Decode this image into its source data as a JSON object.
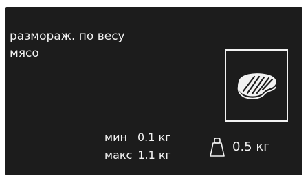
{
  "program": {
    "mode": "размораж. по весу",
    "food": "мясо",
    "food_icon": "meat-steak-icon"
  },
  "limits": {
    "min_label": "мин",
    "min_value": "0.1 кг",
    "max_label": "макс",
    "max_value": "1.1 кг"
  },
  "weight": {
    "icon": "weight-icon",
    "value": "0.5 кг"
  },
  "colors": {
    "background": "#1c1c1c",
    "foreground": "#f2f2f2"
  }
}
